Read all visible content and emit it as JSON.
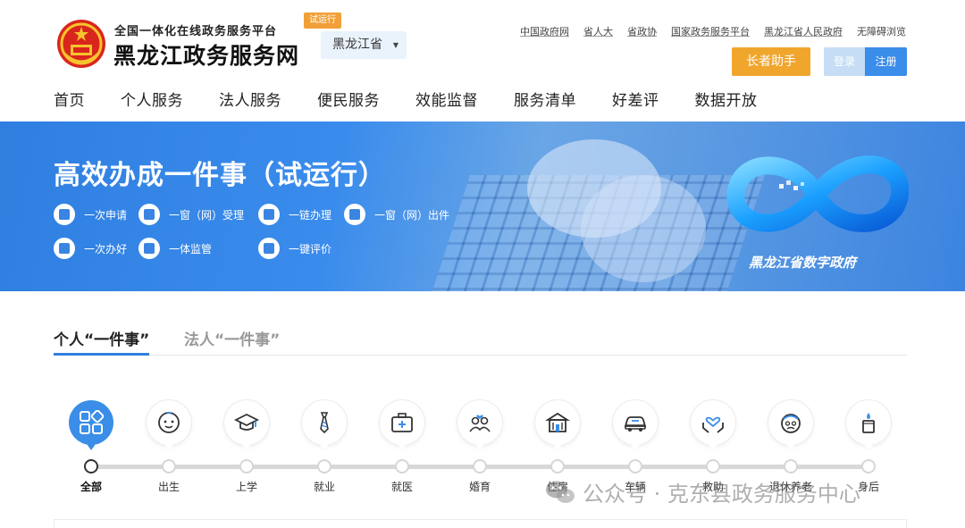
{
  "header": {
    "subtitle": "全国一体化在线政务服务平台",
    "title": "黑龙江政务服务网",
    "badge": "试运行",
    "province": "黑龙江省",
    "top_links": [
      "中国政府网",
      "省人大",
      "省政协",
      "国家政务服务平台",
      "黑龙江省人民政府",
      "无障碍浏览"
    ],
    "elder_button": "长者助手",
    "login": "登录",
    "register": "注册"
  },
  "nav": {
    "items": [
      "首页",
      "个人服务",
      "法人服务",
      "便民服务",
      "效能监督",
      "服务清单",
      "好差评",
      "数据开放"
    ]
  },
  "banner": {
    "title": "高效办成一件事（试运行）",
    "features": [
      "一次申请",
      "一窗（网）受理",
      "一链办理",
      "一窗（网）出件",
      "一次办好",
      "一体监管",
      "一键评价"
    ],
    "logo_label": "黑龙江省数字政府"
  },
  "tabs": {
    "person": "个人“一件事”",
    "legal": "法人“一件事”"
  },
  "categories": [
    {
      "label": "全部",
      "icon": "grid-icon"
    },
    {
      "label": "出生",
      "icon": "baby-icon"
    },
    {
      "label": "上学",
      "icon": "graduation-cap-icon"
    },
    {
      "label": "就业",
      "icon": "tie-icon"
    },
    {
      "label": "就医",
      "icon": "medical-kit-icon"
    },
    {
      "label": "婚育",
      "icon": "couple-icon"
    },
    {
      "label": "住房",
      "icon": "house-icon"
    },
    {
      "label": "车辆",
      "icon": "car-icon"
    },
    {
      "label": "救助",
      "icon": "helping-hands-icon"
    },
    {
      "label": "退休养老",
      "icon": "elder-icon"
    },
    {
      "label": "身后",
      "icon": "candle-icon"
    }
  ],
  "watermark": "公众号 · 克东县政务服务中心",
  "colors": {
    "accent": "#2f7fe0",
    "elder_button": "#f0a62d",
    "badge": "#f1a039",
    "register": "#3a8de8"
  }
}
